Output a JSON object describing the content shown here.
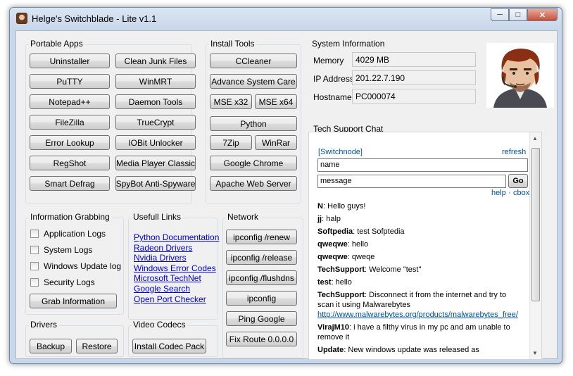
{
  "window": {
    "title": "Helge's Switchblade - Lite v1.1"
  },
  "portable_apps": {
    "label": "Portable Apps",
    "buttons": [
      "Uninstaller",
      "Clean Junk Files",
      "PuTTY",
      "WinMRT",
      "Notepad++",
      "Daemon Tools",
      "FileZilla",
      "TrueCrypt",
      "Error Lookup",
      "IOBit Unlocker",
      "RegShot",
      "Media Player Classic",
      "Smart Defrag",
      "SpyBot Anti-Spyware"
    ]
  },
  "install_tools": {
    "label": "Install Tools",
    "ccleaner": "CCleaner",
    "advance_system_care": "Advance System Care",
    "mse_x32": "MSE x32",
    "mse_x64": "MSE x64",
    "python": "Python",
    "zip7": "7Zip",
    "winrar": "WinRar",
    "google_chrome": "Google Chrome",
    "apache": "Apache Web Server"
  },
  "system_info": {
    "label": "System Information",
    "memory_label": "Memory",
    "memory_value": "4029 MB",
    "ip_label": "IP Address",
    "ip_value": "201.22.7.190",
    "hostname_label": "Hostname",
    "hostname_value": "PC000074"
  },
  "info_grabbing": {
    "label": "Information Grabbing",
    "checks": [
      "Application Logs",
      "System Logs",
      "Windows Update log",
      "Security Logs"
    ],
    "grab_button": "Grab Information"
  },
  "useful_links": {
    "label": "Usefull Links",
    "links": [
      "Python Documentation",
      "Radeon Drivers",
      "Nvidia Drivers",
      "Windows Error Codes",
      "Microsoft TechNet",
      "Google Search",
      "Open Port Checker"
    ]
  },
  "network": {
    "label": "Network",
    "buttons": [
      "ipconfig /renew",
      "ipconfig /release",
      "ipconfig /flushdns",
      "ipconfig",
      "Ping Google",
      "Fix Route 0.0.0.0"
    ]
  },
  "drivers": {
    "label": "Drivers",
    "backup": "Backup",
    "restore": "Restore"
  },
  "video_codecs": {
    "label": "Video Codecs",
    "install": "Install Codec Pack"
  },
  "chat": {
    "label": "Tech Support Chat",
    "header_link": "[Switchnode]",
    "refresh": "refresh",
    "name_value": "name",
    "message_value": "message",
    "go": "Go",
    "help": "help",
    "sep": "·",
    "cbox": "cbox",
    "messages": [
      {
        "who": "N",
        "text": ": Hello guys!"
      },
      {
        "who": "jj",
        "text": ": halp"
      },
      {
        "who": "Softpedia",
        "text": ": test Sofptedia"
      },
      {
        "who": "qweqwe",
        "text": ": hello"
      },
      {
        "who": "qweqwe",
        "text": ": qweqe"
      },
      {
        "who": "TechSupport",
        "text": ": Welcome \"test\""
      },
      {
        "who": "test",
        "text": ": hello"
      },
      {
        "who": "TechSupport",
        "text": ": Disconnect it from the internet and try to scan it using Malwarebytes"
      },
      {
        "who": "VirajM10",
        "text": ": i have a filthy virus in my pc and am unable to remove it"
      },
      {
        "who": "Update",
        "text": ": New windows update was released as"
      }
    ],
    "url": "http://www.malwarebytes.org/products/malwarebytes_free/"
  }
}
